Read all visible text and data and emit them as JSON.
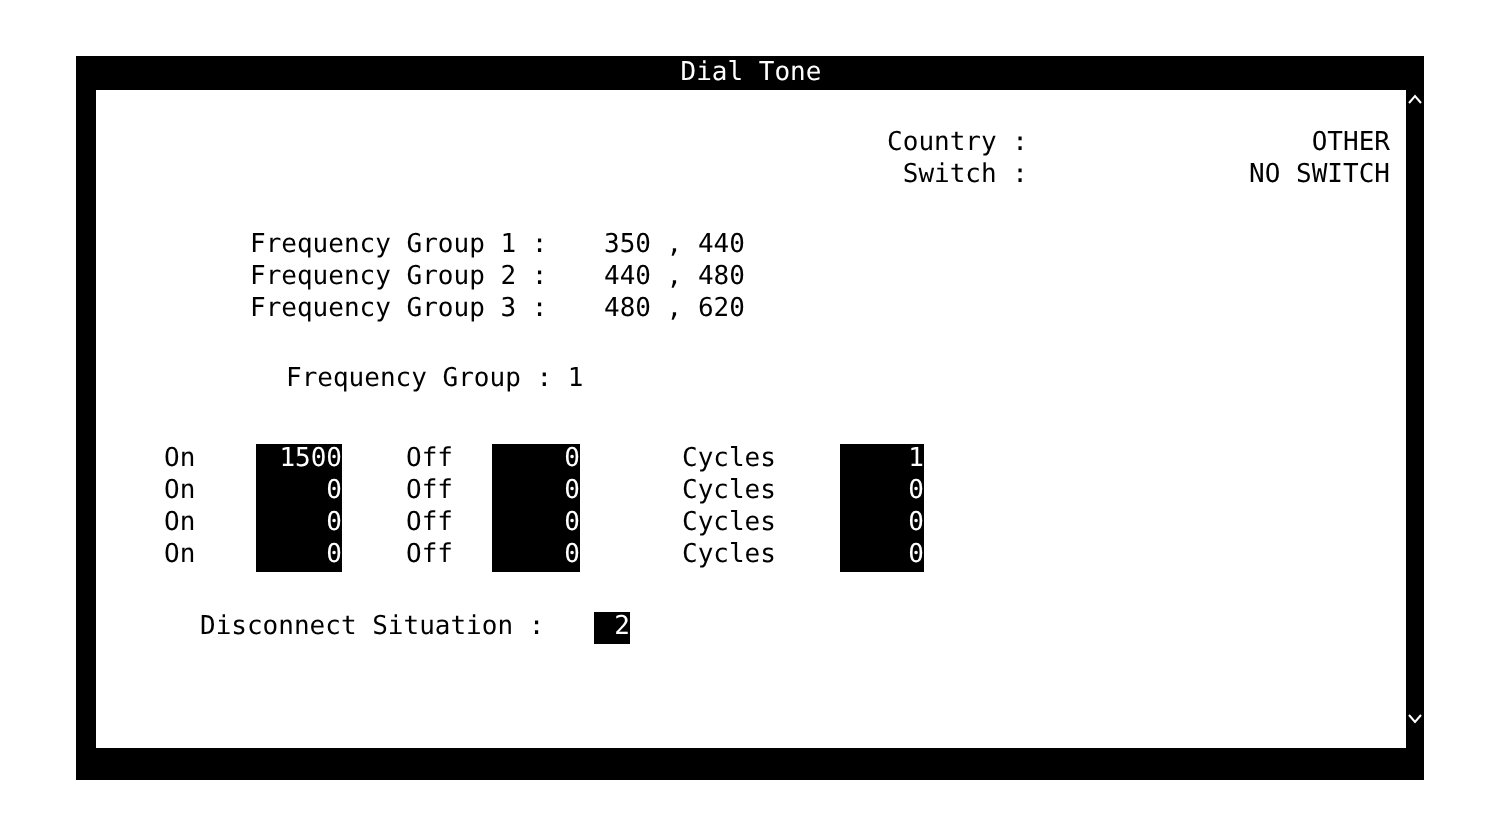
{
  "window": {
    "title": "Dial Tone"
  },
  "location": [
    {
      "label": "Country :",
      "value": "OTHER"
    },
    {
      "label": "Switch :",
      "value": "NO SWITCH"
    }
  ],
  "frequency_groups": [
    {
      "label": "Frequency Group 1 :",
      "value": "350 , 440"
    },
    {
      "label": "Frequency Group 2 :",
      "value": "440 , 480"
    },
    {
      "label": "Frequency Group 3 :",
      "value": "480 , 620"
    }
  ],
  "selected_group": {
    "label": "Frequency Group :",
    "value": "1"
  },
  "cadence": [
    {
      "on_label": "On",
      "on": "1500",
      "off_label": "Off",
      "off": "0",
      "cycles_label": "Cycles",
      "cycles": "1"
    },
    {
      "on_label": "On",
      "on": "0",
      "off_label": "Off",
      "off": "0",
      "cycles_label": "Cycles",
      "cycles": "0"
    },
    {
      "on_label": "On",
      "on": "0",
      "off_label": "Off",
      "off": "0",
      "cycles_label": "Cycles",
      "cycles": "0"
    },
    {
      "on_label": "On",
      "on": "0",
      "off_label": "Off",
      "off": "0",
      "cycles_label": "Cycles",
      "cycles": "0"
    }
  ],
  "disconnect": {
    "label": "Disconnect Situation :",
    "value": "2"
  }
}
